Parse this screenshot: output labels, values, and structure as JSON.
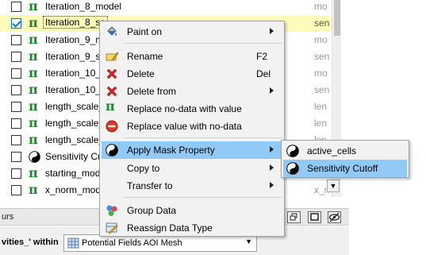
{
  "tree": {
    "rows": [
      {
        "name": "Iteration_8_model",
        "type": "mo",
        "icon": "pi-icon",
        "checked": false,
        "selected": false
      },
      {
        "name": "Iteration_8_se",
        "type": "sen",
        "icon": "pi-icon",
        "checked": true,
        "selected": true
      },
      {
        "name": "Iteration_9_m",
        "type": "mo",
        "icon": "pi-icon",
        "checked": false,
        "selected": false
      },
      {
        "name": "Iteration_9_s",
        "type": "sen",
        "icon": "pi-icon",
        "checked": false,
        "selected": false
      },
      {
        "name": "Iteration_10_r",
        "type": "mo",
        "icon": "pi-icon",
        "checked": false,
        "selected": false
      },
      {
        "name": "Iteration_10_s",
        "type": "sen",
        "icon": "pi-icon",
        "checked": false,
        "selected": false
      },
      {
        "name": "length_scale_",
        "type": "len",
        "icon": "pi-icon",
        "checked": false,
        "selected": false
      },
      {
        "name": "length_scale_",
        "type": "len",
        "icon": "pi-icon",
        "checked": false,
        "selected": false
      },
      {
        "name": "length_scale_",
        "type": "len",
        "icon": "pi-icon",
        "checked": false,
        "selected": false
      },
      {
        "name": "Sensitivity Cu",
        "type": "",
        "icon": "yinyang-icon",
        "checked": false,
        "selected": false
      },
      {
        "name": "starting_mod",
        "type": "sta",
        "icon": "pi-icon",
        "checked": false,
        "selected": false
      },
      {
        "name": "x_norm_mod",
        "type": "x_n",
        "icon": "pi-icon",
        "checked": false,
        "selected": false
      }
    ]
  },
  "bottombar": {
    "label": "urs"
  },
  "filter": {
    "label": "vities_' within",
    "mesh_value": "Potential Fields AOI Mesh"
  },
  "context_menu": {
    "items": [
      {
        "label": "Paint on",
        "shortcut": "",
        "submenu": true,
        "icon": "paint-bucket-icon"
      },
      {
        "label": "Rename",
        "shortcut": "F2",
        "submenu": false,
        "icon": "rename-pencil-icon"
      },
      {
        "label": "Delete",
        "shortcut": "Del",
        "submenu": false,
        "icon": "red-x-icon"
      },
      {
        "label": "Delete from",
        "shortcut": "",
        "submenu": true,
        "icon": "red-x-icon"
      },
      {
        "label": "Replace no-data with value",
        "shortcut": "",
        "submenu": false,
        "icon": "pi-icon"
      },
      {
        "label": "Replace value with no-data",
        "shortcut": "",
        "submenu": false,
        "icon": "no-entry-icon"
      },
      {
        "label": "Apply Mask Property",
        "shortcut": "",
        "submenu": true,
        "icon": "yinyang-icon"
      },
      {
        "label": "Copy to",
        "shortcut": "",
        "submenu": true,
        "icon": ""
      },
      {
        "label": "Transfer to",
        "shortcut": "",
        "submenu": true,
        "icon": ""
      },
      {
        "label": "Group Data",
        "shortcut": "",
        "submenu": false,
        "icon": "group-data-icon"
      },
      {
        "label": "Reassign Data Type",
        "shortcut": "",
        "submenu": false,
        "icon": "reassign-type-icon"
      }
    ]
  },
  "submenu": {
    "items": [
      {
        "label": "active_cells",
        "icon": "yinyang-icon"
      },
      {
        "label": "Sensitivity Cutoff",
        "icon": "yinyang-icon"
      }
    ]
  },
  "colors": {
    "highlight": "#91c9f7",
    "selected_row": "#fffbb8",
    "pi_green": "#1d8a2a",
    "delete_red": "#d42020"
  }
}
